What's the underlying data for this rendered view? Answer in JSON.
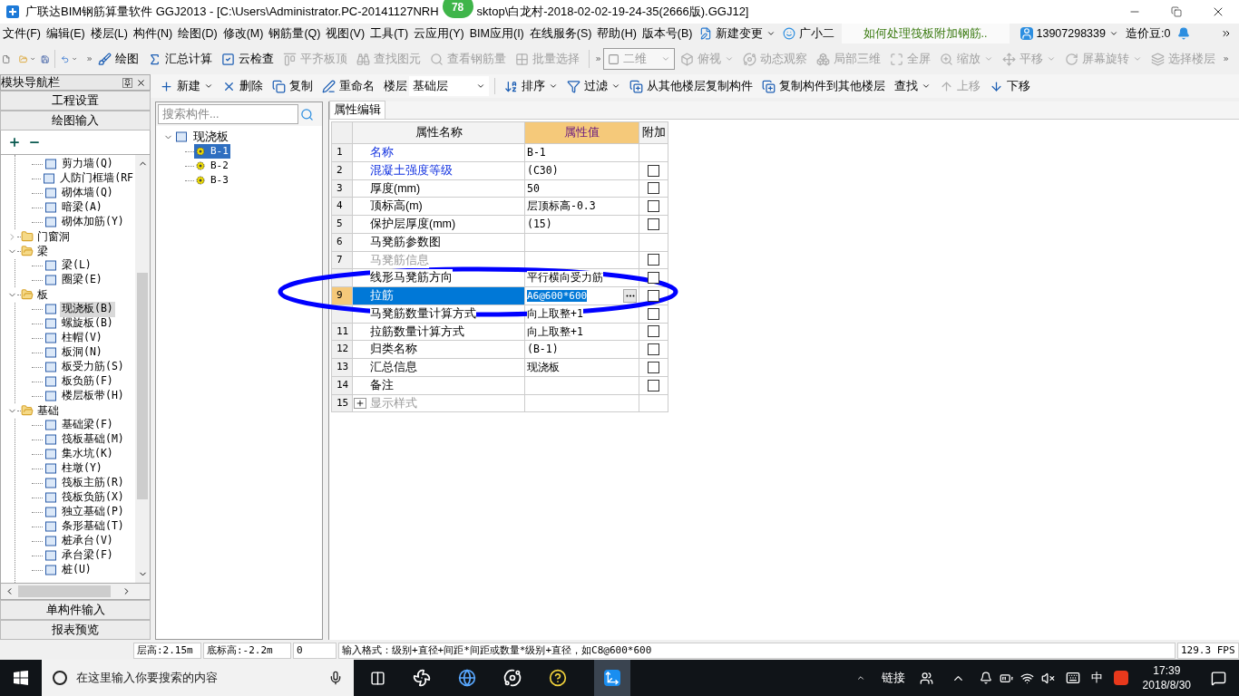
{
  "window": {
    "title_start": "广联达BIM钢筋算量软件 GGJ2013 - [C:\\Users\\Administrator.PC-20141127NRH",
    "title_end": "sktop\\白龙村-2018-02-02-19-24-35(2666版).GGJ12]",
    "badge": "78"
  },
  "menu": [
    "文件(F)",
    "编辑(E)",
    "楼层(L)",
    "构件(N)",
    "绘图(D)",
    "修改(M)",
    "钢筋量(Q)",
    "视图(V)",
    "工具(T)",
    "云应用(Y)",
    "BIM应用(I)",
    "在线服务(S)",
    "帮助(H)",
    "版本号(B)"
  ],
  "menu_extras": {
    "change": "新建变更",
    "assistant": "广小二",
    "tip": "如何处理筏板附加钢筋..",
    "account": "13907298339",
    "beans": "造价豆:0"
  },
  "toolbar": [
    {
      "label": "绘图",
      "disabled": false
    },
    {
      "label": "汇总计算",
      "disabled": false
    },
    {
      "label": "云检查",
      "disabled": false
    },
    {
      "label": "平齐板顶",
      "disabled": true
    },
    {
      "label": "查找图元",
      "disabled": true
    },
    {
      "label": "查看钢筋量",
      "disabled": true
    },
    {
      "label": "批量选择",
      "disabled": true
    }
  ],
  "view_select": "二维",
  "view_tools": [
    {
      "label": "俯视",
      "disabled": true,
      "dropdown": true
    },
    {
      "label": "动态观察",
      "disabled": true,
      "dropdown": false
    },
    {
      "label": "局部三维",
      "disabled": true,
      "dropdown": false
    },
    {
      "label": "全屏",
      "disabled": true,
      "dropdown": false
    },
    {
      "label": "缩放",
      "disabled": true,
      "dropdown": true
    },
    {
      "label": "平移",
      "disabled": true,
      "dropdown": true
    },
    {
      "label": "屏幕旋转",
      "disabled": true,
      "dropdown": true
    },
    {
      "label": "选择楼层",
      "disabled": true,
      "dropdown": false
    }
  ],
  "component_toolbar": [
    {
      "label": "新建",
      "disabled": false,
      "dropdown": true
    },
    {
      "label": "删除",
      "disabled": false,
      "dropdown": false
    },
    {
      "label": "复制",
      "disabled": false,
      "dropdown": false
    },
    {
      "label": "重命名",
      "disabled": false,
      "dropdown": false
    }
  ],
  "floor": {
    "label": "楼层",
    "value": "基础层"
  },
  "component_toolbar_2": [
    {
      "label": "排序",
      "disabled": false,
      "dropdown": true
    },
    {
      "label": "过滤",
      "disabled": false,
      "dropdown": true
    },
    {
      "label": "从其他楼层复制构件",
      "disabled": false,
      "dropdown": false
    },
    {
      "label": "复制构件到其他楼层",
      "disabled": false,
      "dropdown": false
    },
    {
      "label": "查找",
      "disabled": false,
      "dropdown": true
    },
    {
      "label": "上移",
      "disabled": true,
      "dropdown": false
    },
    {
      "label": "下移",
      "disabled": false,
      "dropdown": false
    }
  ],
  "nav": {
    "title": "模块导航栏",
    "sections_top": [
      "工程设置",
      "绘图输入"
    ],
    "sections_bottom": [
      "单构件输入",
      "报表预览"
    ],
    "continued_items": [
      {
        "label": "剪力墙(Q)",
        "selected": false
      },
      {
        "label": "人防门框墙(RF",
        "selected": false
      },
      {
        "label": "砌体墙(Q)",
        "selected": false
      },
      {
        "label": "暗梁(A)",
        "selected": false
      },
      {
        "label": "砌体加筋(Y)",
        "selected": false
      }
    ],
    "folders": [
      {
        "label": "门窗洞",
        "expanded": false
      },
      {
        "label": "梁",
        "expanded": true,
        "children": [
          {
            "label": "梁(L)",
            "selected": false
          },
          {
            "label": "圈梁(E)",
            "selected": false
          }
        ]
      },
      {
        "label": "板",
        "expanded": true,
        "children": [
          {
            "label": "现浇板(B)",
            "selected": true
          },
          {
            "label": "螺旋板(B)",
            "selected": false
          },
          {
            "label": "柱帽(V)",
            "selected": false
          },
          {
            "label": "板洞(N)",
            "selected": false
          },
          {
            "label": "板受力筋(S)",
            "selected": false
          },
          {
            "label": "板负筋(F)",
            "selected": false
          },
          {
            "label": "楼层板带(H)",
            "selected": false
          }
        ]
      },
      {
        "label": "基础",
        "expanded": true,
        "children": [
          {
            "label": "基础梁(F)",
            "selected": false
          },
          {
            "label": "筏板基础(M)",
            "selected": false
          },
          {
            "label": "集水坑(K)",
            "selected": false
          },
          {
            "label": "柱墩(Y)",
            "selected": false
          },
          {
            "label": "筏板主筋(R)",
            "selected": false
          },
          {
            "label": "筏板负筋(X)",
            "selected": false
          },
          {
            "label": "独立基础(P)",
            "selected": false
          },
          {
            "label": "条形基础(T)",
            "selected": false
          },
          {
            "label": "桩承台(V)",
            "selected": false
          },
          {
            "label": "承台梁(F)",
            "selected": false
          },
          {
            "label": "桩(U)",
            "selected": false
          }
        ]
      }
    ]
  },
  "components": {
    "search_placeholder": "搜索构件...",
    "group": {
      "label": "现浇板",
      "expanded": true,
      "children": [
        {
          "label": "B-1",
          "selected": true
        },
        {
          "label": "B-2",
          "selected": false
        },
        {
          "label": "B-3",
          "selected": false
        }
      ]
    }
  },
  "properties": {
    "tab": "属性编辑",
    "columns": [
      {
        "label": "属性名称",
        "selected": false
      },
      {
        "label": "属性值",
        "selected": true
      },
      {
        "label": "附加",
        "selected": false
      }
    ],
    "rows": [
      {
        "number": "1",
        "name": "名称",
        "kind": "link",
        "value": "B-1",
        "selected": false
      },
      {
        "number": "2",
        "name": "混凝土强度等级",
        "kind": "link",
        "value": "(C30)",
        "checked": false,
        "selected": false
      },
      {
        "number": "3",
        "name": "厚度(mm)",
        "kind": "plain",
        "value": "50",
        "checked": false,
        "selected": false
      },
      {
        "number": "4",
        "name": "顶标高(m)",
        "kind": "plain",
        "value": "层顶标高-0.3",
        "checked": false,
        "selected": false
      },
      {
        "number": "5",
        "name": "保护层厚度(mm)",
        "kind": "plain",
        "value": "(15)",
        "checked": false,
        "selected": false
      },
      {
        "number": "6",
        "name": "马凳筋参数图",
        "kind": "plain",
        "selected": false
      },
      {
        "number": "7",
        "name": "马凳筋信息",
        "kind": "dimmed",
        "checked": false,
        "selected": false
      },
      {
        "name": "线形马凳筋方向",
        "kind": "plain",
        "value": "平行横向受力筋",
        "checked": false,
        "selected": false
      },
      {
        "number": "9",
        "name": "拉筋",
        "kind": "plain",
        "value": "A6@600*600",
        "checked": false,
        "selected": true
      },
      {
        "name": "马凳筋数量计算方式",
        "kind": "plain",
        "value": "向上取整+1",
        "checked": false,
        "selected": false
      },
      {
        "number": "11",
        "name": "拉筋数量计算方式",
        "kind": "plain",
        "value": "向上取整+1",
        "checked": false,
        "selected": false
      },
      {
        "number": "12",
        "name": "归类名称",
        "kind": "plain",
        "value": "(B-1)",
        "checked": false,
        "selected": false
      },
      {
        "number": "13",
        "name": "汇总信息",
        "kind": "plain",
        "value": "现浇板",
        "checked": false,
        "selected": false
      },
      {
        "number": "14",
        "name": "备注",
        "kind": "plain",
        "checked": false,
        "selected": false
      },
      {
        "number": "15",
        "name": "显示样式",
        "kind": "dimmed",
        "expanded": false,
        "selected": false
      }
    ]
  },
  "status_bar": [
    "层高:2.15m",
    "底标高:-2.2m",
    "0",
    "输入格式：级别+直径+间距*间距或数量*级别+直径，如C8@600*600",
    "129.3 FPS"
  ],
  "taskbar": {
    "search_placeholder": "在这里输入你要搜索的内容",
    "links": "链接",
    "ime": "中",
    "time": "17:39",
    "date": "2018/8/30"
  }
}
